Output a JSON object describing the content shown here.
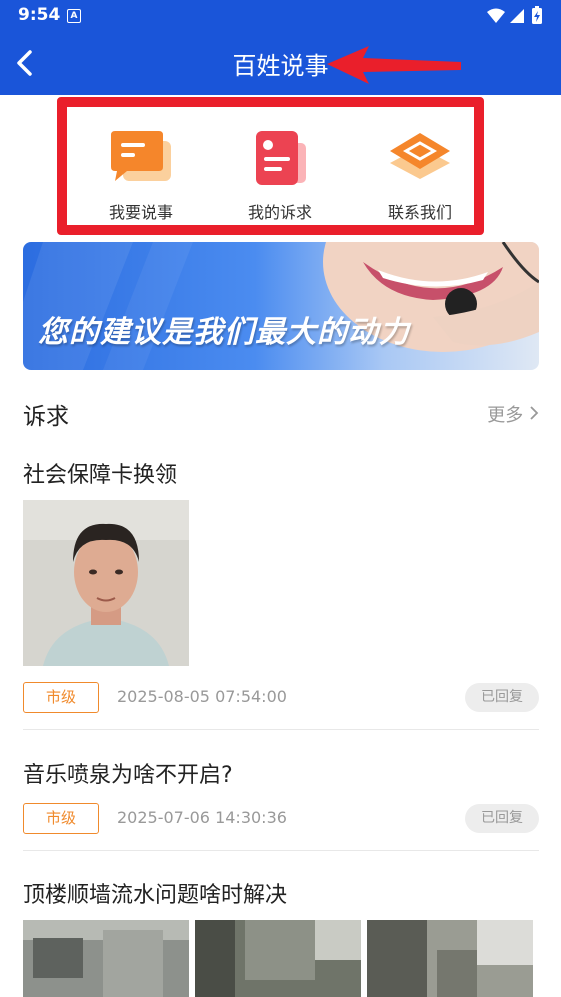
{
  "status_bar": {
    "time": "9:54",
    "notification_icon": "A"
  },
  "header": {
    "title": "百姓说事"
  },
  "quick_menu": [
    {
      "label": "我要说事",
      "icon": "chat-bubble-icon"
    },
    {
      "label": "我的诉求",
      "icon": "document-icon"
    },
    {
      "label": "联系我们",
      "icon": "layers-icon"
    }
  ],
  "banner": {
    "slogan": "您的建议是我们最大的动力"
  },
  "section": {
    "title": "诉求",
    "more_label": "更多"
  },
  "posts": [
    {
      "title": "社会保障卡换领",
      "tag": "市级",
      "date": "2025-08-05 07:54:00",
      "status": "已回复"
    },
    {
      "title": "音乐喷泉为啥不开启?",
      "tag": "市级",
      "date": "2025-07-06 14:30:36",
      "status": "已回复"
    },
    {
      "title": "顶楼顺墙流水问题啥时解决"
    }
  ],
  "colors": {
    "primary": "#1a55d9",
    "highlight": "#ea1f2b",
    "tag": "#f08a2c"
  }
}
